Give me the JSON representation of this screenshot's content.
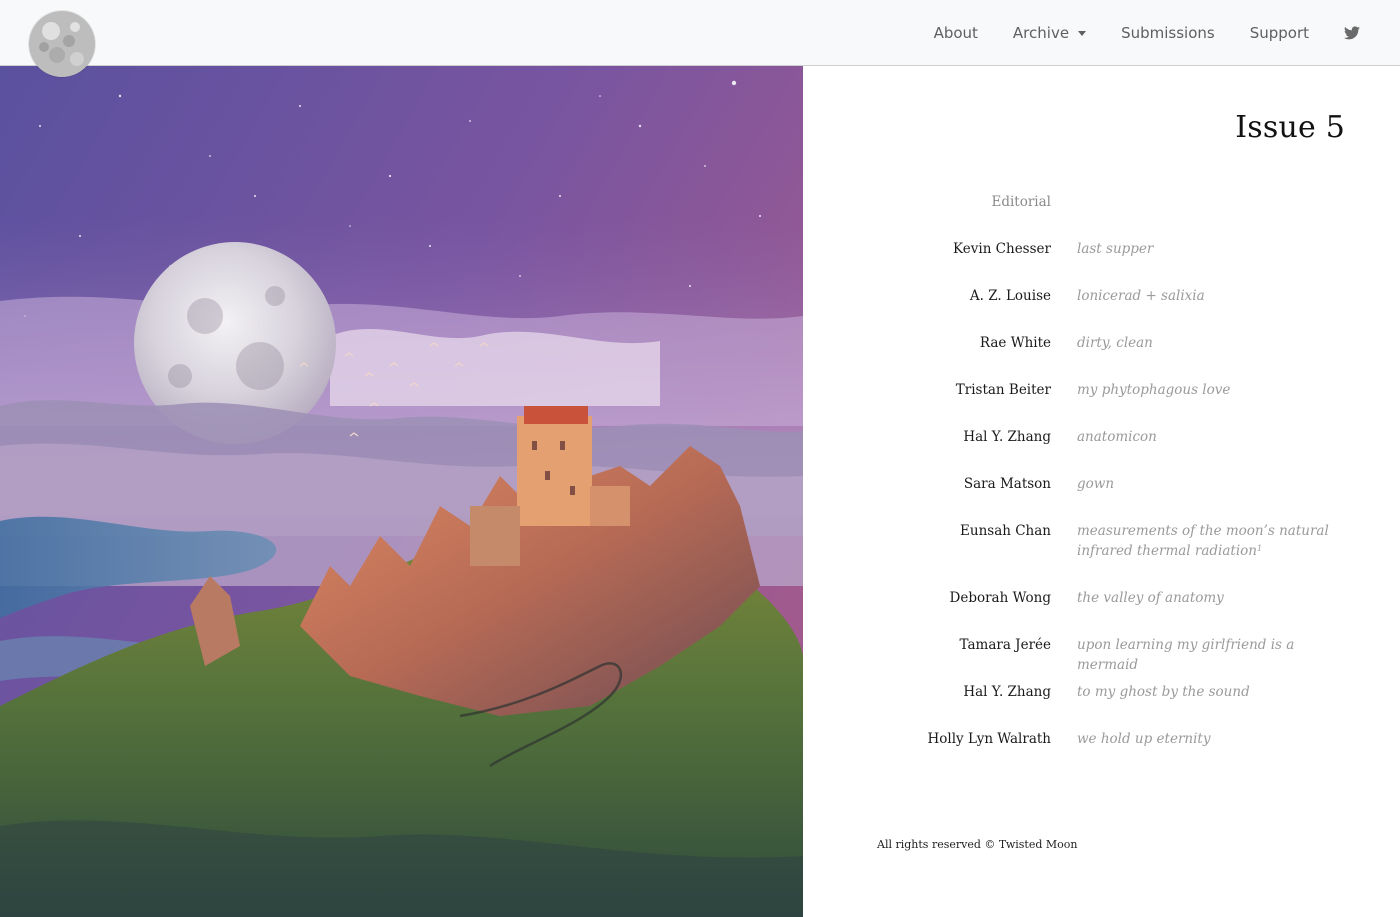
{
  "nav": {
    "logo_alt": "",
    "links": [
      {
        "label": "About"
      },
      {
        "label": "Archive"
      },
      {
        "label": "Submissions"
      },
      {
        "label": "Support"
      }
    ],
    "social_icon": "twitter-icon"
  },
  "issue": {
    "title": "Issue 5",
    "editorial_label": "Editorial",
    "entries": [
      {
        "author": "Kevin Chesser",
        "piece": "last supper"
      },
      {
        "author": "A. Z. Louise",
        "piece": "lonicerad + salixia"
      },
      {
        "author": "Rae White",
        "piece": "dirty, clean"
      },
      {
        "author": "Tristan Beiter",
        "piece": "my phytophagous love"
      },
      {
        "author": "Hal Y. Zhang",
        "piece": "anatomicon"
      },
      {
        "author": "Sara Matson",
        "piece": "gown"
      },
      {
        "author": "Eunsah Chan",
        "piece": "measurements of the moon’s natural infrared thermal radiation",
        "footnote": "1"
      },
      {
        "author": "Deborah Wong",
        "piece": "the valley of anatomy"
      },
      {
        "author": "Tamara Jerée",
        "piece": "upon learning my girlfriend is a mermaid"
      },
      {
        "author": "Hal Y. Zhang",
        "piece": "to my ghost by the sound"
      },
      {
        "author": "Holly Lyn Walrath",
        "piece": "we hold up eternity"
      }
    ]
  },
  "footer": {
    "text": "All rights reserved © Twisted Moon"
  },
  "colors": {
    "navbar_bg": "#f8f9fa",
    "sky_top": "#5b4f9e",
    "sky_right": "#9a5690",
    "text_muted": "#9a9a9a"
  }
}
